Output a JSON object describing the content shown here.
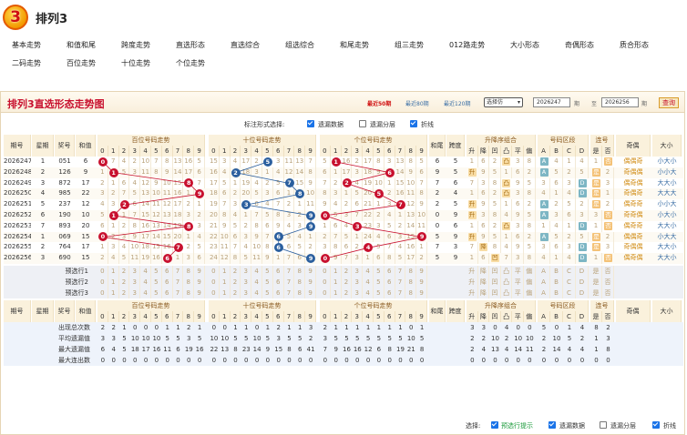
{
  "header": {
    "logo": "排列3",
    "logo_digit": "3",
    "title": "排列3"
  },
  "nav": [
    "基本走势",
    "和值和尾",
    "跨度走势",
    "直选形态",
    "直选综合",
    "组选综合",
    "和尾走势",
    "组三走势",
    "012路走势",
    "大小形态",
    "奇偶形态",
    "质合形态",
    "二码走势",
    "百位走势",
    "十位走势",
    "个位走势"
  ],
  "panel": {
    "title": "排列3直选形态走势图",
    "periods": [
      "最近50期",
      "最近80期",
      "最近120期"
    ],
    "active_period": "最近50期",
    "select_value": "选择仿",
    "from_value": "2026247",
    "from_unit": "期",
    "to_label": "至",
    "to_value": "2026256",
    "to_unit": "期",
    "query_label": "查询"
  },
  "options": {
    "label": "标注形式选择:",
    "items": [
      {
        "label": "遗漏数据",
        "checked": true
      },
      {
        "label": "遗漏分层",
        "checked": false
      },
      {
        "label": "折线",
        "checked": true
      }
    ]
  },
  "table": {
    "headers": {
      "period": "期号",
      "weekday": "星期",
      "prize": "奖号",
      "sum": "和值",
      "group_bai": "百位号码走势",
      "group_shi": "十位号码走势",
      "group_ge": "个位号码走势",
      "sum_tail": "和尾",
      "span": "跨度",
      "updown": "升降序组合",
      "zone": "号码区段",
      "consec": "连号",
      "oddeven": "奇偶",
      "bigsmall": "大小"
    },
    "digits": [
      "0",
      "1",
      "2",
      "3",
      "4",
      "5",
      "6",
      "7",
      "8",
      "9"
    ],
    "updown_sub": [
      "升",
      "降",
      "凹",
      "凸",
      "平",
      "偏"
    ],
    "zone_sub": [
      "A",
      "B",
      "C",
      "D"
    ],
    "consec_sub": [
      "是",
      "否"
    ],
    "rows": [
      {
        "period": "2026247",
        "weekday": "1",
        "prize": "051",
        "sum": "6",
        "bai": 0,
        "shi": 5,
        "ge": 1,
        "tail": "6",
        "span": "5",
        "oe": "偶偶奇",
        "bs": "小大小"
      },
      {
        "period": "2026248",
        "weekday": "2",
        "prize": "126",
        "sum": "9",
        "bai": 1,
        "shi": 2,
        "ge": 6,
        "tail": "9",
        "span": "5",
        "oe": "奇偶偶",
        "bs": "小小大"
      },
      {
        "period": "2026249",
        "weekday": "3",
        "prize": "872",
        "sum": "17",
        "bai": 8,
        "shi": 7,
        "ge": 2,
        "tail": "7",
        "span": "6",
        "oe": "偶奇偶",
        "bs": "大大小"
      },
      {
        "period": "2026250",
        "weekday": "4",
        "prize": "985",
        "sum": "22",
        "bai": 9,
        "shi": 8,
        "ge": 5,
        "tail": "2",
        "span": "4",
        "oe": "奇偶奇",
        "bs": "大大大"
      },
      {
        "period": "2026251",
        "weekday": "5",
        "prize": "237",
        "sum": "12",
        "bai": 2,
        "shi": 3,
        "ge": 7,
        "tail": "2",
        "span": "5",
        "oe": "偶奇奇",
        "bs": "小小大"
      },
      {
        "period": "2026252",
        "weekday": "6",
        "prize": "190",
        "sum": "10",
        "bai": 1,
        "shi": 9,
        "ge": 0,
        "tail": "0",
        "span": "9",
        "oe": "奇奇偶",
        "bs": "小大小"
      },
      {
        "period": "2026253",
        "weekday": "7",
        "prize": "893",
        "sum": "20",
        "bai": 8,
        "shi": 9,
        "ge": 3,
        "tail": "0",
        "span": "6",
        "oe": "偶奇奇",
        "bs": "大大小"
      },
      {
        "period": "2026254",
        "weekday": "1",
        "prize": "069",
        "sum": "15",
        "bai": 0,
        "shi": 6,
        "ge": 9,
        "tail": "5",
        "span": "9",
        "oe": "偶偶奇",
        "bs": "小大大"
      },
      {
        "period": "2026255",
        "weekday": "2",
        "prize": "764",
        "sum": "17",
        "bai": 7,
        "shi": 6,
        "ge": 4,
        "tail": "7",
        "span": "3",
        "oe": "奇偶偶",
        "bs": "大大小"
      },
      {
        "period": "2026256",
        "weekday": "3",
        "prize": "690",
        "sum": "15",
        "bai": 6,
        "shi": 9,
        "ge": 0,
        "tail": "5",
        "span": "9",
        "oe": "偶奇偶",
        "bs": "大大小"
      }
    ],
    "pred_rows": [
      "预选行1",
      "预选行2",
      "预选行3"
    ],
    "stats": [
      {
        "label": "出现总次数",
        "bai": "2 2 1 0 0 0 1 1 2 1",
        "shi": "0 0 1 1 0 1 2 1 1 3",
        "ge": "2 1 1 1 1 1 1 1 0 1",
        "ud": "3 3 0 4 0 0",
        "zone": "5 0 1 4",
        "consec": "8 2"
      },
      {
        "label": "平均遗漏值",
        "bai": "3 3 5 10 10 10 5 5 3 5",
        "shi": "10 10 5 5 10 5 3 5 5 2",
        "ge": "3 5 5 5 5 5 5 5 10 5",
        "ud": "2 2 10 2 10 10",
        "zone": "2 10 5 2",
        "consec": "1 3"
      },
      {
        "label": "最大遗漏值",
        "bai": "6 4 5 18 17 16 11 6 19 16",
        "shi": "22 13 8 23 14 9 15 8 6 41",
        "ge": "7 9 16 16 12 6 8 19 21 8",
        "ud": "2 4 13 4 14 11",
        "zone": "2 14 4 4",
        "consec": "1 8"
      },
      {
        "label": "最大连出数",
        "bai": "0 0 0 0 0 0 0 0 0 0",
        "shi": "0 0 0 0 0 0 0 0 0 0",
        "ge": "0 0 0 0 0 0 0 0 0 0",
        "ud": "0 0 0 0 0 0",
        "zone": "0 0 0 0",
        "consec": "0 0"
      }
    ]
  },
  "footer": {
    "label": "选择:",
    "items": [
      {
        "label": "预选行提示",
        "checked": true,
        "green": true
      },
      {
        "label": "遗漏数据",
        "checked": true
      },
      {
        "label": "遗漏分层",
        "checked": false
      },
      {
        "label": "折线",
        "checked": true
      }
    ]
  },
  "colors": {
    "red": "#c8102e",
    "blue": "#2b5f9e",
    "orange": "#f4c277"
  }
}
